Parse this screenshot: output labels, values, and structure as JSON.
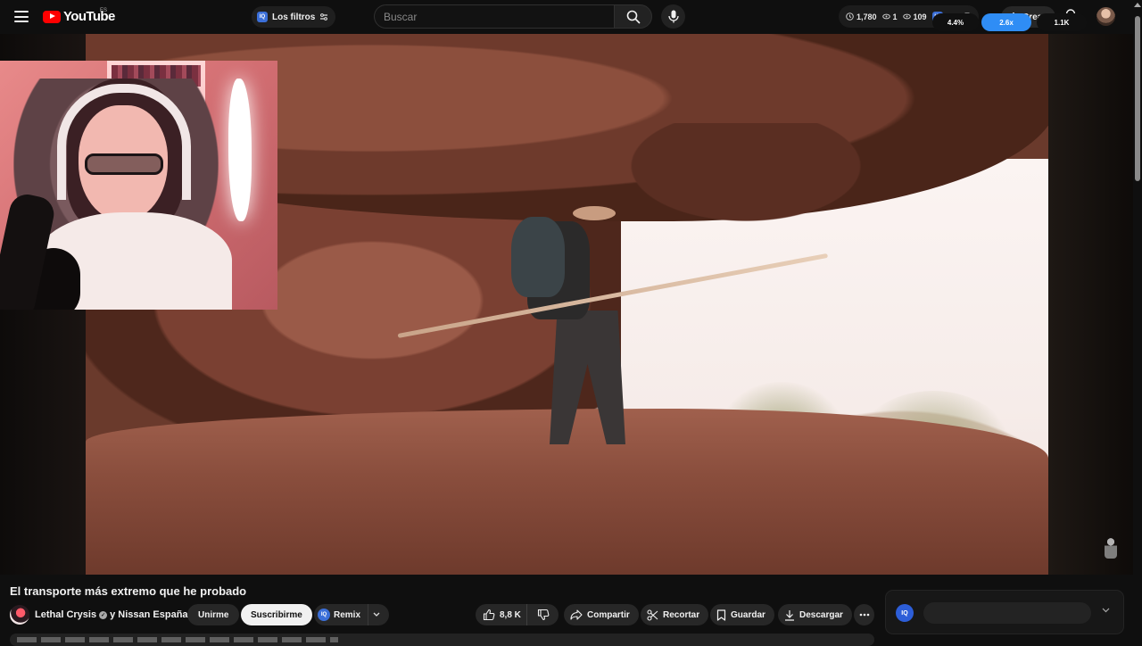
{
  "header": {
    "logo_text": "YouTube",
    "region": "ES",
    "filters_label": "Los filtros",
    "iq_badge": "IQ",
    "search_placeholder": "Buscar",
    "stats": [
      {
        "icon": "clock-icon",
        "value": "1,780"
      },
      {
        "icon": "eye-icon",
        "value": "1"
      },
      {
        "icon": "eye-icon",
        "value": "109"
      }
    ],
    "create_label": "Crear"
  },
  "video": {
    "title": "El transporte más extremo que he probado",
    "channel": "Lethal Crysis",
    "collab": "y Nissan España",
    "join_label": "Unirme",
    "subscribe_label": "Suscribirme",
    "remix_label": "Remix",
    "likes": "8,8 K",
    "share_label": "Compartir",
    "clip_label": "Recortar",
    "save_label": "Guardar",
    "download_label": "Descargar"
  },
  "iq_panel": {
    "logo": "IQ",
    "metrics": [
      "4.4%",
      "2.6x",
      "1.1K"
    ],
    "accent": "#2f8df5"
  },
  "colors": {
    "background": "#0f0f0f",
    "brand_red": "#ff0000",
    "subscribe_bg": "#f1f1f1"
  }
}
